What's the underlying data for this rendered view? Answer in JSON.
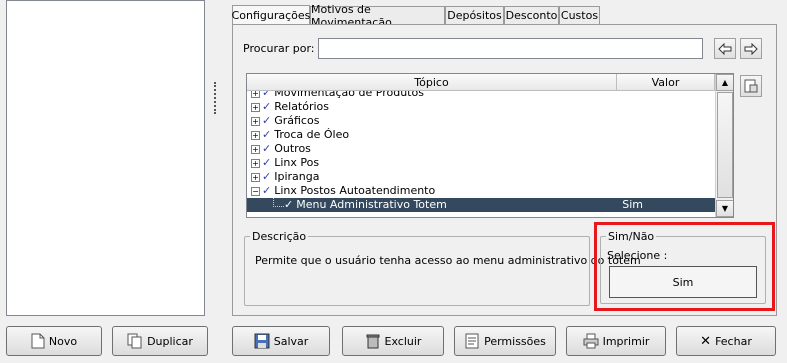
{
  "tabs": [
    "Configurações",
    "Motivos de Movimentação",
    "Depósitos",
    "Desconto",
    "Custos"
  ],
  "search": {
    "label": "Procurar por:",
    "value": ""
  },
  "grid": {
    "columns": {
      "topic": "Tópico",
      "value": "Valor"
    },
    "rows": [
      {
        "label": "Movimentação de Produtos",
        "value": ""
      },
      {
        "label": "Relatórios",
        "value": ""
      },
      {
        "label": "Gráficos",
        "value": ""
      },
      {
        "label": "Troca de Óleo",
        "value": ""
      },
      {
        "label": "Outros",
        "value": ""
      },
      {
        "label": "Linx Pos",
        "value": ""
      },
      {
        "label": "Ipiranga",
        "value": ""
      },
      {
        "label": "Linx Postos Autoatendimento",
        "value": ""
      },
      {
        "label": "Menu Administrativo Totem",
        "value": "Sim"
      }
    ]
  },
  "description": {
    "legend": "Descrição",
    "text": "Permite que o usuário tenha acesso ao menu administrativo do totem"
  },
  "simnao": {
    "legend": "Sim/Não",
    "select_label": "Selecione :",
    "value": "Sim",
    "highlight_color": "#e8171c"
  },
  "left_buttons": {
    "new": "Novo",
    "duplicate": "Duplicar"
  },
  "bottom_buttons": {
    "save": "Salvar",
    "delete": "Excluir",
    "permissions": "Permissões",
    "print": "Imprimir",
    "close": "Fechar"
  },
  "colors": {
    "selection": "#34495e",
    "check": "#2c3fb0"
  }
}
